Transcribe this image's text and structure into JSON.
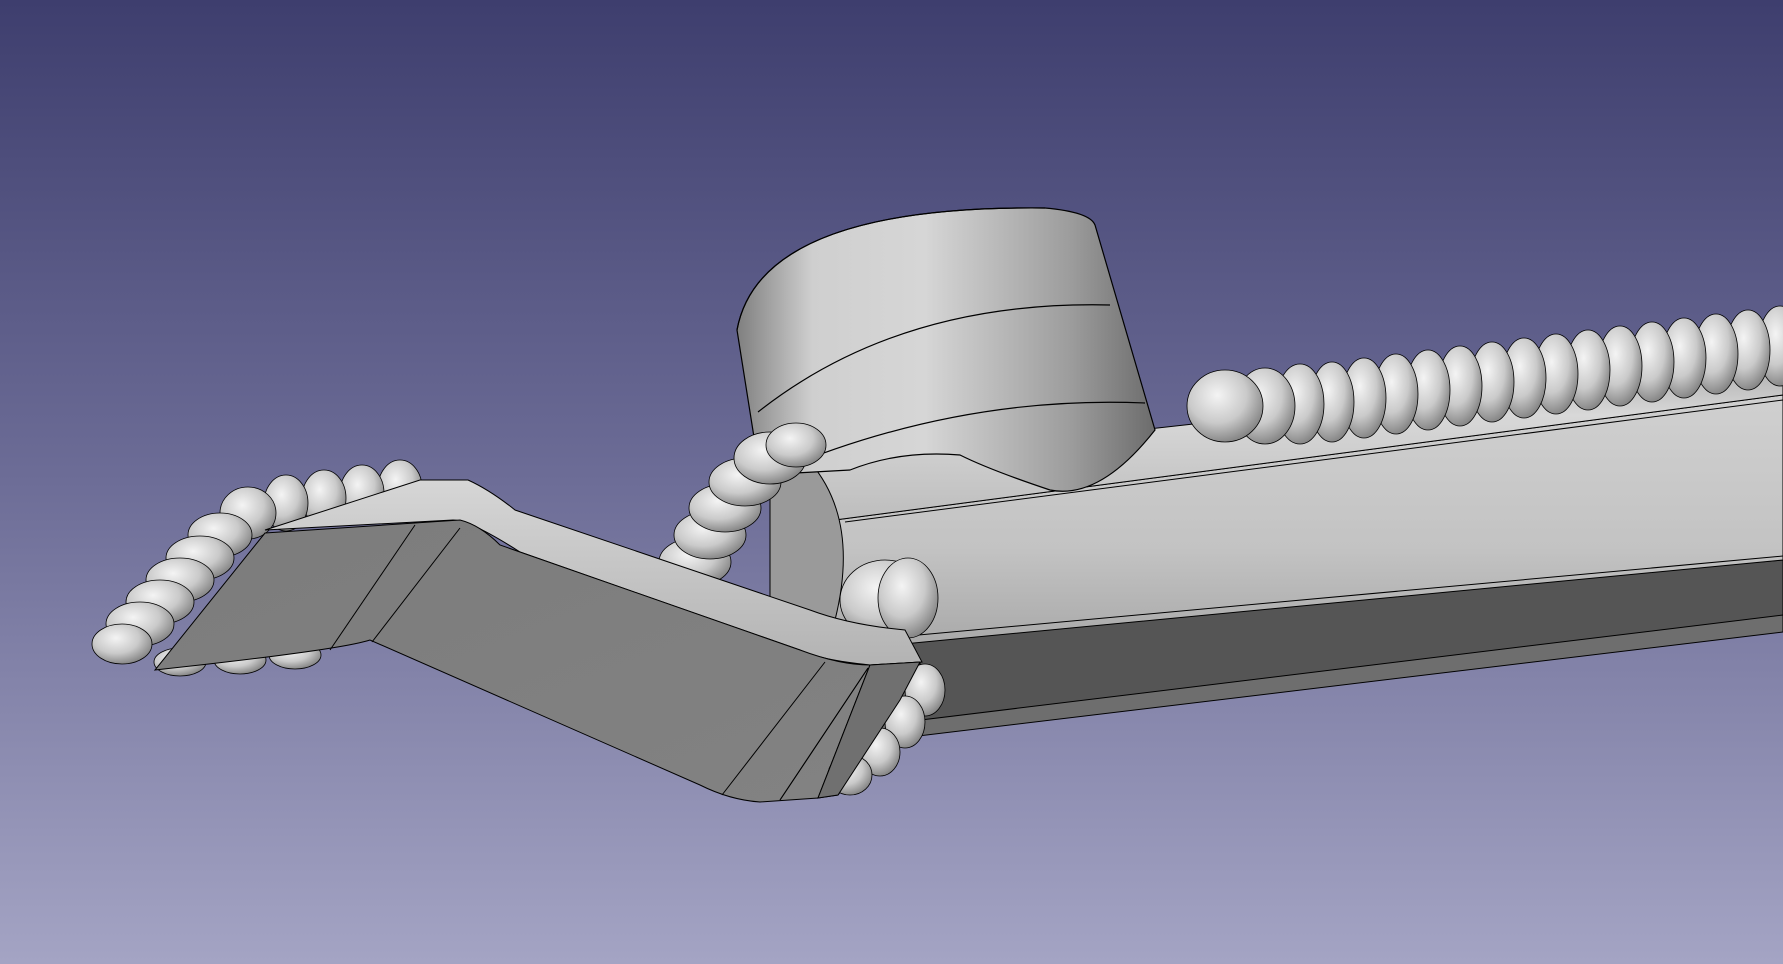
{
  "viewport": {
    "background_top": "#3f3f6f",
    "background_bottom": "#a3a3c3",
    "model_color": "#c8c8c8",
    "edge_color": "#000000"
  },
  "model": {
    "parts": [
      {
        "name": "main-tube"
      },
      {
        "name": "cylinder-boss"
      },
      {
        "name": "bent-bracket"
      },
      {
        "name": "weld-beads"
      }
    ]
  }
}
